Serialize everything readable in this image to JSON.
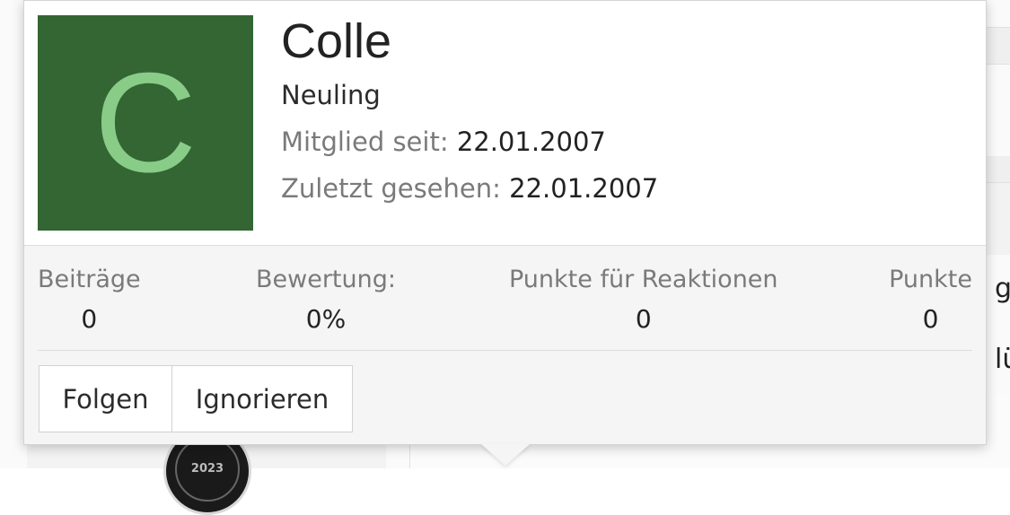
{
  "background": {
    "peek_text_1": "g",
    "peek_text_2": "lü",
    "badge_year": "2023"
  },
  "user_card": {
    "avatar": {
      "letter": "C",
      "bg_color": "#336633",
      "fg_color": "#88cc88"
    },
    "username": "Colle",
    "role": "Neuling",
    "member_since_label": "Mitglied seit:",
    "member_since_value": "22.01.2007",
    "last_seen_label": "Zuletzt gesehen:",
    "last_seen_value": "22.01.2007",
    "stats": [
      {
        "label": "Beiträge",
        "value": "0"
      },
      {
        "label": "Bewertung:",
        "value": "0%"
      },
      {
        "label": "Punkte für Reaktionen",
        "value": "0"
      },
      {
        "label": "Punkte",
        "value": "0"
      }
    ],
    "actions": {
      "follow_label": "Folgen",
      "ignore_label": "Ignorieren"
    }
  }
}
